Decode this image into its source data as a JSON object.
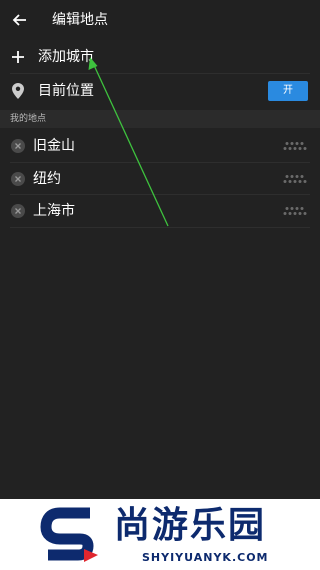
{
  "header": {
    "back_icon": "arrow-left-icon",
    "title": "编辑地点"
  },
  "add_city": {
    "icon": "plus-icon",
    "label": "添加城市"
  },
  "current_location": {
    "icon": "location-pin-icon",
    "label": "目前位置",
    "toggle_label": "开",
    "toggle_color": "#2a8ae0"
  },
  "section": {
    "title": "我的地点"
  },
  "places": [
    {
      "name": "旧金山",
      "remove_icon": "remove-circle-icon",
      "handle_icon": "drag-handle-icon"
    },
    {
      "name": "纽约",
      "remove_icon": "remove-circle-icon",
      "handle_icon": "drag-handle-icon"
    },
    {
      "name": "上海市",
      "remove_icon": "remove-circle-icon",
      "handle_icon": "drag-handle-icon"
    }
  ],
  "watermark": {
    "title": "尚游乐园",
    "url": "SHYIYUANYK.COM",
    "brand_color": "#0d2a6e",
    "accent": "#e0262e"
  },
  "annotation": {
    "arrow_color": "#3ec23e"
  }
}
